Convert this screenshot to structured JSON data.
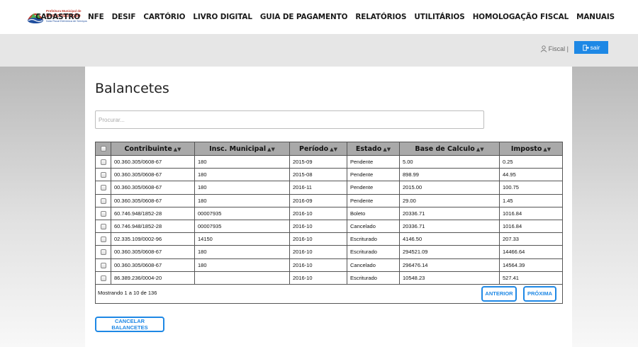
{
  "header": {
    "logo": {
      "line1": "Prefeitura Municipal de",
      "line2": "Demonstração",
      "line3": "Nota Fiscal Eletrônica de Serviços"
    },
    "nav": [
      "CADASTRO",
      "NFE",
      "DESIF",
      "CARTÓRIO",
      "LIVRO DIGITAL",
      "GUIA DE PAGAMENTO",
      "RELATÓRIOS",
      "UTILITÁRIOS",
      "HOMOLOGAÇÃO FISCAL",
      "MANUAIS"
    ]
  },
  "userbar": {
    "user_label": "Fiscal |",
    "logout_label": "sair"
  },
  "page": {
    "title": "Balancetes",
    "search_placeholder": "Procurar..."
  },
  "table": {
    "columns": [
      "Contribuinte",
      "Insc. Municipal",
      "Período",
      "Estado",
      "Base de Calculo",
      "Imposto"
    ],
    "rows": [
      [
        "00.360.305/0608-67",
        "180",
        "2015-09",
        "Pendente",
        "5.00",
        "0.25"
      ],
      [
        "00.360.305/0608-67",
        "180",
        "2015-08",
        "Pendente",
        "898.99",
        "44.95"
      ],
      [
        "00.360.305/0608-67",
        "180",
        "2016-11",
        "Pendente",
        "2015.00",
        "100.75"
      ],
      [
        "00.360.305/0608-67",
        "180",
        "2016-09",
        "Pendente",
        "29.00",
        "1.45"
      ],
      [
        "60.746.948/1852-28",
        "00007935",
        "2016-10",
        "Boleto",
        "20336.71",
        "1016.84"
      ],
      [
        "60.746.948/1852-28",
        "00007935",
        "2016-10",
        "Cancelado",
        "20336.71",
        "1016.84"
      ],
      [
        "02.335.109/0002-96",
        "14150",
        "2016-10",
        "Escriturado",
        "4146.50",
        "207.33"
      ],
      [
        "00.360.305/0608-67",
        "180",
        "2016-10",
        "Escriturado",
        "294521.09",
        "14466.64"
      ],
      [
        "00.360.305/0608-67",
        "180",
        "2016-10",
        "Cancelado",
        "296476.14",
        "14564.39"
      ],
      [
        "86.389.236/0004-20",
        "",
        "2016-10",
        "Escriturado",
        "10548.23",
        "527.41"
      ]
    ],
    "showing": "Mostrando 1 a 10 de 136",
    "prev_label": "ANTERIOR",
    "next_label": "PRÓXIMA"
  },
  "actions": {
    "cancel_label": "CANCELAR BALANCETES"
  },
  "colors": {
    "accent": "#1e88e5",
    "logo_red": "#c0392b",
    "logo_blue": "#1f4e9e",
    "header_gray": "#a9a9a9"
  }
}
